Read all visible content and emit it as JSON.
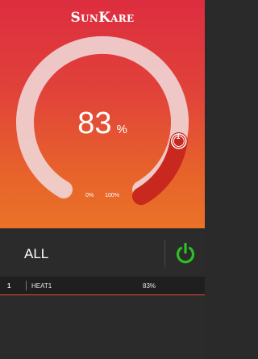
{
  "header": {
    "brand": "SunKare"
  },
  "gauge": {
    "value": 83,
    "value_text": "83",
    "unit": "%",
    "scale_min_label": "0%",
    "scale_max_label": "100%",
    "knob_label": "1"
  },
  "control": {
    "group_label": "ALL",
    "power_icon": "power-icon",
    "power_state": "on"
  },
  "zones": [
    {
      "index": "1",
      "name": "HEAT1",
      "value": "83%"
    }
  ],
  "colors": {
    "accent_top": "#dd2d3f",
    "accent_bottom": "#ea7227",
    "power_green": "#2fbf25",
    "bar_dark": "#2b2b2b"
  }
}
